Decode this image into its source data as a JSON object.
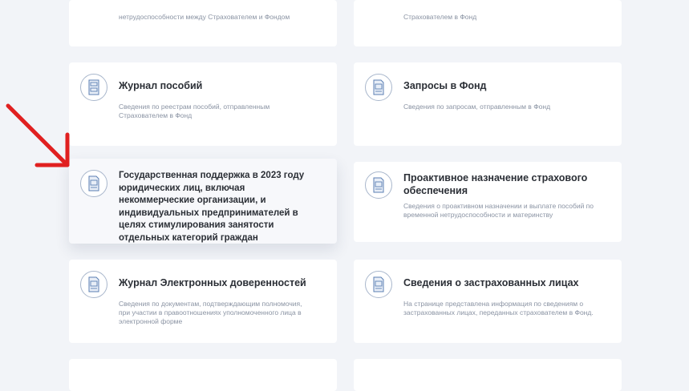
{
  "cards": [
    {
      "title": "",
      "desc": "нетрудоспособности между Страхователем и Фондом",
      "icon": "document-icon"
    },
    {
      "title": "",
      "desc": "Страхователем в Фонд",
      "icon": "document-icon"
    },
    {
      "title": "Журнал пособий",
      "desc": "Сведения по реестрам пособий, отправленным Страхователем в Фонд",
      "icon": "cabinet-icon"
    },
    {
      "title": "Запросы в Фонд",
      "desc": "Сведения по запросам, отправленным в Фонд",
      "icon": "document-icon"
    },
    {
      "title": "Государственная поддержка в 2023 году юридических лиц, включая некоммерческие организации, и индивидуальных предпринимателей в целях стимулирования занятости отдельных категорий граждан",
      "desc": "",
      "icon": "document-icon"
    },
    {
      "title": "Проактивное назначение страхового обеспечения",
      "desc": "Сведения о проактивном назначении и выплате пособий по временной нетрудоспособности и материнству",
      "icon": "document-icon"
    },
    {
      "title": "Журнал Электронных доверенностей",
      "desc": "Сведения по документам, подтверждающим полномочия, при участии в правоотношениях уполномоченного лица в электронной форме",
      "icon": "document-icon"
    },
    {
      "title": "Сведения о застрахованных лицах",
      "desc": "На странице представлена информация по сведениям о застрахованных лицах, переданных страхователем в Фонд.",
      "icon": "document-icon"
    }
  ],
  "annotation": {
    "icon": "red-arrow-icon",
    "color": "#e02020"
  },
  "colors": {
    "background": "#f2f4f8",
    "card": "#ffffff",
    "icon_stroke": "#5b7fb3"
  }
}
